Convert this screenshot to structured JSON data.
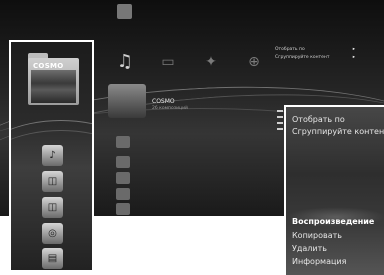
{
  "folder": {
    "name": "COSMO",
    "subtitle": "26 композиций"
  },
  "categories": [
    {
      "icon": "music-icon",
      "glyph": "♫"
    },
    {
      "icon": "video-icon",
      "glyph": "▭"
    },
    {
      "icon": "game-icon",
      "glyph": "✦"
    },
    {
      "icon": "network-icon",
      "glyph": "⊕"
    }
  ],
  "options_menu": {
    "items": [
      {
        "label": "Отобрать по",
        "arrow": "▸"
      },
      {
        "label": "Сгруппируйте контент",
        "arrow": "▸"
      }
    ]
  },
  "context_menu": {
    "top_items": [
      "Отобрать по",
      "Сгруппируйте контент"
    ],
    "bottom_items": [
      "Воспроизведение",
      "Копировать",
      "Удалить",
      "Информация"
    ],
    "selected": "Воспроизведение"
  },
  "track_icons": [
    {
      "icon": "music-track-icon",
      "glyph": "♪"
    },
    {
      "icon": "album-art-icon",
      "glyph": "◫"
    },
    {
      "icon": "album-art-icon",
      "glyph": "◫"
    },
    {
      "icon": "disc-icon",
      "glyph": "◎"
    },
    {
      "icon": "folder-icon",
      "glyph": "▤"
    }
  ]
}
